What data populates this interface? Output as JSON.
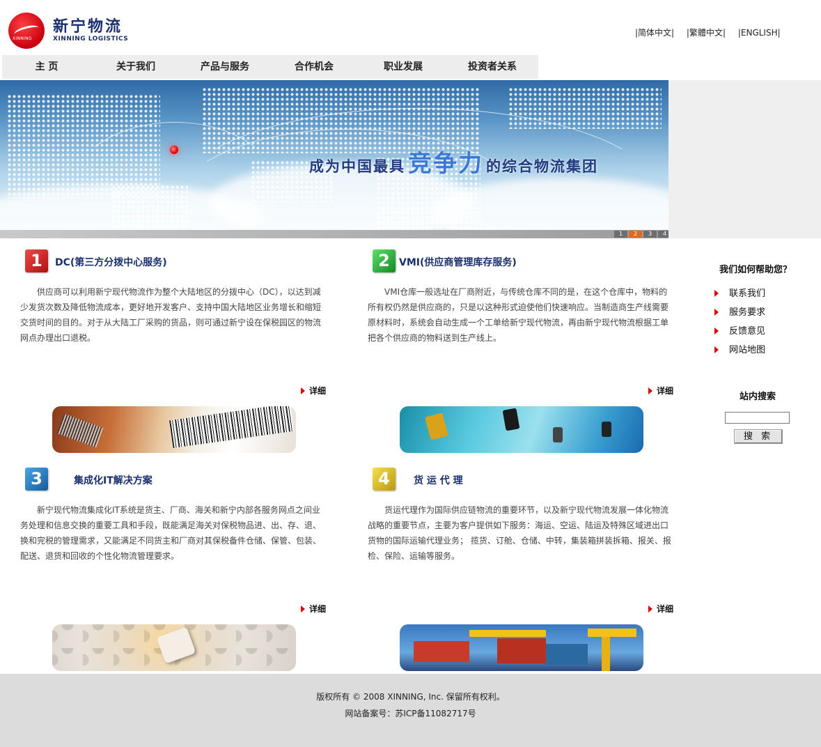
{
  "brand": {
    "name_cn": "新宁物流",
    "name_en": "XINNING LOGISTICS",
    "logo_text": "XINNING"
  },
  "languages": [
    "|简体中文|",
    "|繁體中文|",
    "|ENGLISH|"
  ],
  "nav": [
    "主 页",
    "关于我们",
    "产品与服务",
    "合作机会",
    "职业发展",
    "投资者关系"
  ],
  "banner": {
    "slogan_pre": "成为中国最具",
    "slogan_big": "竞争力",
    "slogan_post": "的综合物流集团",
    "pages": [
      "1",
      "2",
      "3",
      "4"
    ],
    "active_page": 2
  },
  "sections": [
    {
      "num": "1",
      "color": "#d9242a",
      "title": "DC(第三方分拨中心服务)",
      "body": "供应商可以利用新宁现代物流作为整个大陆地区的分拨中心（DC），以达到减少发货次数及降低物流成本，更好地开发客户、支持中国大陆地区业务增长和缩短交货时间的目的。对于从大陆工厂采购的货品，则可通过新宁设在保税园区的物流网点办理出口退税。",
      "more": "详细"
    },
    {
      "num": "2",
      "color": "#2fb640",
      "title": "VMI(供应商管理库存服务)",
      "body": "VMI仓库一般选址在厂商附近，与传统仓库不同的是，在这个仓库中，物料的所有权仍然是供应商的，只是以这种形式迫使他们快速响应。当制造商生产线需要原材料时，系统会自动生成一个工单给新宁现代物流，再由新宁现代物流根据工单把各个供应商的物料送到生产线上。",
      "more": "详细"
    },
    {
      "num": "3",
      "color": "#2a79c0",
      "title": "集成化IT解决方案",
      "body": "新宁现代物流集成化IT系统是货主、厂商、海关和新宁内部各服务网点之间业务处理和信息交换的重要工具和手段，既能满足海关对保税物品进、出、存、退、换和完税的管理需求，又能满足不同货主和厂商对其保税备件仓储、保管、包装、配送、退货和回收的个性化物流管理要求。",
      "more": "详细"
    },
    {
      "num": "4",
      "color": "#e2c21a",
      "title": "货 运 代 理",
      "body": "货运代理作为国际供应链物流的重要环节，以及新宁现代物流发展一体化物流战略的重要节点，主要为客户提供如下服务：海运、空运、陆运及特殊区域进出口货物的国际运输代理业务； 揽货、订舱、仓储、中转，集装箱拼装拆箱、报关、报检、保险、运输等服务。",
      "more": "详细"
    }
  ],
  "sidebar": {
    "help_title": "我们如何帮助您？",
    "help_items": [
      "联系我们",
      "服务要求",
      "反馈意见",
      "网站地图"
    ],
    "search_title": "站内搜索",
    "search_value": "",
    "search_button": "搜 索"
  },
  "footer": {
    "copyright": "版权所有 © 2008 XINNING, Inc. 保留所有权利。",
    "icp": "网站备案号：苏ICP备11082717号"
  }
}
